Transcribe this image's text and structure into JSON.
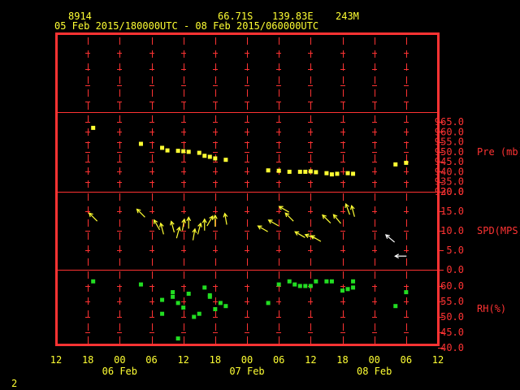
{
  "header": {
    "station_id": "8914",
    "latitude": "66.71S",
    "longitude": "139.83E",
    "elevation": "243M",
    "time_range": "05 Feb 2015/180000UTC - 08 Feb 2015/060000UTC"
  },
  "page_number": "2",
  "colors": {
    "frame": "#ff3333",
    "grid": "#ff3333",
    "text": "#ffff33",
    "pressure": "#ffff33",
    "wind_day": "#ffff33",
    "wind_night": "#ffffff",
    "rh": "#22dd22"
  },
  "chart_data": [
    {
      "type": "scatter",
      "xlabel": "",
      "ylabel": "Pre (mb)",
      "ylim": [
        930,
        968
      ],
      "yticks": [
        "965.0",
        "960.0",
        "955.0",
        "950.0",
        "945.0",
        "940.0",
        "935.0",
        "930.0"
      ],
      "series": [
        {
          "values": [
            {
              "x": "05 Feb 19:00",
              "y": 962.0
            },
            {
              "x": "06 Feb 04:00",
              "y": 954.0
            },
            {
              "x": "06 Feb 08:00",
              "y": 952.0
            },
            {
              "x": "06 Feb 09:00",
              "y": 950.7
            },
            {
              "x": "06 Feb 11:00",
              "y": 950.5
            },
            {
              "x": "06 Feb 12:00",
              "y": 950.3
            },
            {
              "x": "06 Feb 13:00",
              "y": 950.0
            },
            {
              "x": "06 Feb 15:00",
              "y": 949.5
            },
            {
              "x": "06 Feb 16:00",
              "y": 948.0
            },
            {
              "x": "06 Feb 17:00",
              "y": 947.5
            },
            {
              "x": "06 Feb 18:00",
              "y": 946.7
            },
            {
              "x": "06 Feb 20:00",
              "y": 946.0
            },
            {
              "x": "07 Feb 04:00",
              "y": 940.7
            },
            {
              "x": "07 Feb 06:00",
              "y": 940.5
            },
            {
              "x": "07 Feb 08:00",
              "y": 940.0
            },
            {
              "x": "07 Feb 10:00",
              "y": 940.0
            },
            {
              "x": "07 Feb 11:00",
              "y": 940.0
            },
            {
              "x": "07 Feb 12:00",
              "y": 940.2
            },
            {
              "x": "07 Feb 13:00",
              "y": 939.8
            },
            {
              "x": "07 Feb 15:00",
              "y": 939.3
            },
            {
              "x": "07 Feb 16:00",
              "y": 938.7
            },
            {
              "x": "07 Feb 17:00",
              "y": 939.0
            },
            {
              "x": "07 Feb 19:00",
              "y": 939.3
            },
            {
              "x": "07 Feb 20:00",
              "y": 939.0
            },
            {
              "x": "08 Feb 04:00",
              "y": 943.7
            },
            {
              "x": "08 Feb 06:00",
              "y": 944.5
            }
          ]
        }
      ]
    },
    {
      "type": "scatter",
      "xlabel": "",
      "ylabel": "SPD(MPS)",
      "ylim": [
        0,
        20
      ],
      "yticks": [
        "20.0",
        "15.0",
        "10.0",
        "5.0",
        "0.0"
      ],
      "series": [
        {
          "values": [
            {
              "x": "05 Feb 19:00",
              "y": 13.5,
              "dir_deg": 315
            },
            {
              "x": "06 Feb 04:00",
              "y": 14.5,
              "dir_deg": 315
            },
            {
              "x": "06 Feb 07:00",
              "y": 11.5,
              "dir_deg": 330
            },
            {
              "x": "06 Feb 08:00",
              "y": 10.5,
              "dir_deg": 345
            },
            {
              "x": "06 Feb 10:00",
              "y": 11.0,
              "dir_deg": 345
            },
            {
              "x": "06 Feb 11:00",
              "y": 9.5,
              "dir_deg": 15
            },
            {
              "x": "06 Feb 12:00",
              "y": 11.5,
              "dir_deg": 10
            },
            {
              "x": "06 Feb 13:00",
              "y": 12.0,
              "dir_deg": 0
            },
            {
              "x": "06 Feb 14:00",
              "y": 9.0,
              "dir_deg": 10
            },
            {
              "x": "06 Feb 15:00",
              "y": 10.5,
              "dir_deg": 15
            },
            {
              "x": "06 Feb 16:00",
              "y": 11.5,
              "dir_deg": 0
            },
            {
              "x": "06 Feb 17:00",
              "y": 12.5,
              "dir_deg": 30
            },
            {
              "x": "06 Feb 18:00",
              "y": 12.5,
              "dir_deg": 0
            },
            {
              "x": "06 Feb 20:00",
              "y": 13.0,
              "dir_deg": 350
            },
            {
              "x": "07 Feb 03:00",
              "y": 10.5,
              "dir_deg": 300
            },
            {
              "x": "07 Feb 05:00",
              "y": 12.0,
              "dir_deg": 300
            },
            {
              "x": "07 Feb 07:00",
              "y": 15.5,
              "dir_deg": 300
            },
            {
              "x": "07 Feb 08:00",
              "y": 13.5,
              "dir_deg": 315
            },
            {
              "x": "07 Feb 10:00",
              "y": 9.0,
              "dir_deg": 300
            },
            {
              "x": "07 Feb 12:00",
              "y": 8.5,
              "dir_deg": 290
            },
            {
              "x": "07 Feb 13:00",
              "y": 8.0,
              "dir_deg": 300
            },
            {
              "x": "07 Feb 15:00",
              "y": 13.0,
              "dir_deg": 315
            },
            {
              "x": "07 Feb 17:00",
              "y": 13.0,
              "dir_deg": 320
            },
            {
              "x": "07 Feb 19:00",
              "y": 15.5,
              "dir_deg": 340
            },
            {
              "x": "07 Feb 20:00",
              "y": 15.0,
              "dir_deg": 345
            },
            {
              "x": "08 Feb 03:00",
              "y": 8.0,
              "dir_deg": 310
            },
            {
              "x": "08 Feb 05:00",
              "y": 3.5,
              "dir_deg": 270
            }
          ]
        }
      ]
    },
    {
      "type": "scatter",
      "xlabel": "",
      "ylabel": "RH(%)",
      "ylim": [
        40,
        63
      ],
      "yticks": [
        "60.0",
        "55.0",
        "50.0",
        "45.0",
        "40.0"
      ],
      "xticks": [
        "12",
        "18",
        "00",
        "06",
        "12",
        "18",
        "00",
        "06",
        "12",
        "18",
        "00",
        "06",
        "12"
      ],
      "xdates": [
        "06 Feb",
        "07 Feb",
        "08 Feb"
      ],
      "series": [
        {
          "values": [
            {
              "x": "05 Feb 19:00",
              "y": 61.5
            },
            {
              "x": "06 Feb 04:00",
              "y": 60.5
            },
            {
              "x": "06 Feb 08:00",
              "y": 55.5
            },
            {
              "x": "06 Feb 08:00",
              "y": 51.0
            },
            {
              "x": "06 Feb 10:00",
              "y": 58.0
            },
            {
              "x": "06 Feb 10:00",
              "y": 56.5
            },
            {
              "x": "06 Feb 11:00",
              "y": 54.5
            },
            {
              "x": "06 Feb 11:00",
              "y": 43.0
            },
            {
              "x": "06 Feb 12:00",
              "y": 53.0
            },
            {
              "x": "06 Feb 13:00",
              "y": 57.5
            },
            {
              "x": "06 Feb 14:00",
              "y": 50.0
            },
            {
              "x": "06 Feb 15:00",
              "y": 51.0
            },
            {
              "x": "06 Feb 16:00",
              "y": 59.5
            },
            {
              "x": "06 Feb 17:00",
              "y": 57.0
            },
            {
              "x": "06 Feb 17:00",
              "y": 56.5
            },
            {
              "x": "06 Feb 18:00",
              "y": 52.5
            },
            {
              "x": "06 Feb 19:00",
              "y": 54.5
            },
            {
              "x": "06 Feb 20:00",
              "y": 53.5
            },
            {
              "x": "07 Feb 04:00",
              "y": 54.5
            },
            {
              "x": "07 Feb 06:00",
              "y": 60.5
            },
            {
              "x": "07 Feb 08:00",
              "y": 61.5
            },
            {
              "x": "07 Feb 09:00",
              "y": 60.5
            },
            {
              "x": "07 Feb 10:00",
              "y": 60.0
            },
            {
              "x": "07 Feb 11:00",
              "y": 60.0
            },
            {
              "x": "07 Feb 12:00",
              "y": 60.0
            },
            {
              "x": "07 Feb 13:00",
              "y": 61.5
            },
            {
              "x": "07 Feb 15:00",
              "y": 61.5
            },
            {
              "x": "07 Feb 16:00",
              "y": 61.5
            },
            {
              "x": "07 Feb 18:00",
              "y": 58.5
            },
            {
              "x": "07 Feb 19:00",
              "y": 59.0
            },
            {
              "x": "07 Feb 20:00",
              "y": 61.5
            },
            {
              "x": "07 Feb 20:00",
              "y": 59.5
            },
            {
              "x": "08 Feb 04:00",
              "y": 53.5
            },
            {
              "x": "08 Feb 06:00",
              "y": 58.0
            }
          ]
        }
      ]
    }
  ]
}
